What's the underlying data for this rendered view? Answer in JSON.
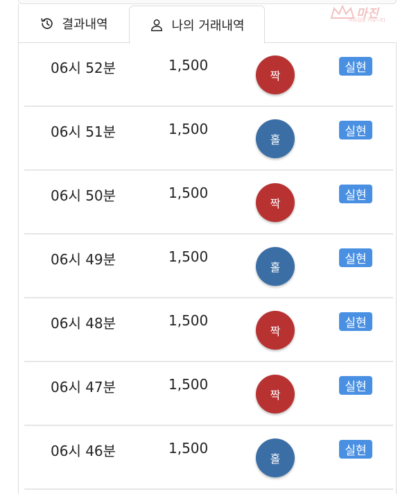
{
  "tabs": {
    "results_label": "결과내역",
    "mine_label": "나의 거래내역"
  },
  "watermark": {
    "title": "마진",
    "subtitle": "먹튀검증 커뮤니티"
  },
  "colors": {
    "even": "#b83232",
    "odd": "#3a6ea5",
    "badge": "#4a90e2"
  },
  "trades": [
    {
      "time": "06시 52분",
      "amount": "1,500",
      "result": "짝",
      "result_type": "even",
      "status": "실현"
    },
    {
      "time": "06시 51분",
      "amount": "1,500",
      "result": "홀",
      "result_type": "odd",
      "status": "실현"
    },
    {
      "time": "06시 50분",
      "amount": "1,500",
      "result": "짝",
      "result_type": "even",
      "status": "실현"
    },
    {
      "time": "06시 49분",
      "amount": "1,500",
      "result": "홀",
      "result_type": "odd",
      "status": "실현"
    },
    {
      "time": "06시 48분",
      "amount": "1,500",
      "result": "짝",
      "result_type": "even",
      "status": "실현"
    },
    {
      "time": "06시 47분",
      "amount": "1,500",
      "result": "짝",
      "result_type": "even",
      "status": "실현"
    },
    {
      "time": "06시 46분",
      "amount": "1,500",
      "result": "홀",
      "result_type": "odd",
      "status": "실현"
    }
  ]
}
